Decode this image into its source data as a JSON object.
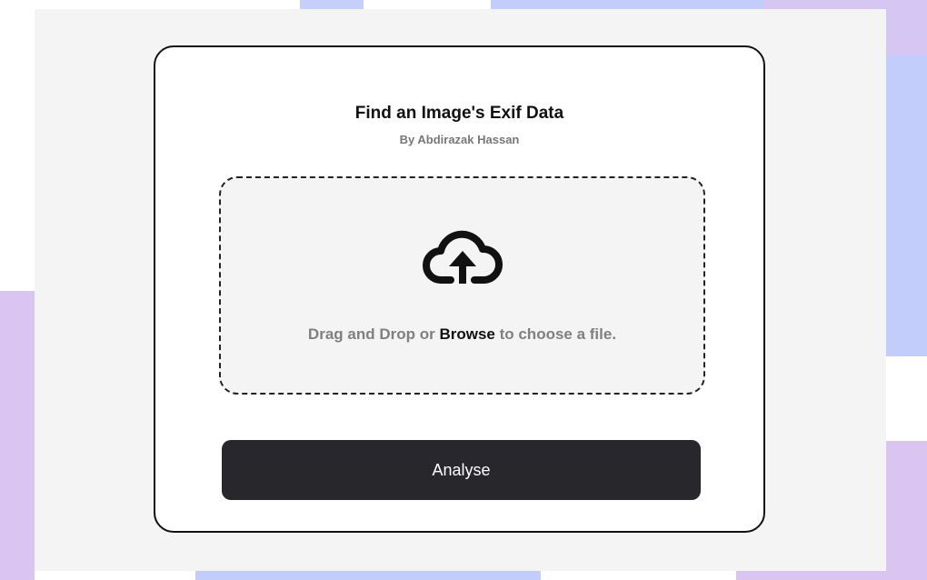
{
  "app": {
    "title": "Find an Image's Exif Data",
    "author": "By Abdirazak Hassan"
  },
  "dropzone": {
    "text_before": "Drag and Drop or ",
    "browse_label": "Browse",
    "text_after": " to choose a file.",
    "icon": "cloud-upload-icon"
  },
  "actions": {
    "analyse_label": "Analyse"
  },
  "colors": {
    "panel_background": "#f4f4f4",
    "card_border": "#111111",
    "button_background": "#28272c",
    "muted_text": "#808080",
    "decor_blue": "#c3cdfb",
    "decor_lilac": "#d9c4f2"
  }
}
